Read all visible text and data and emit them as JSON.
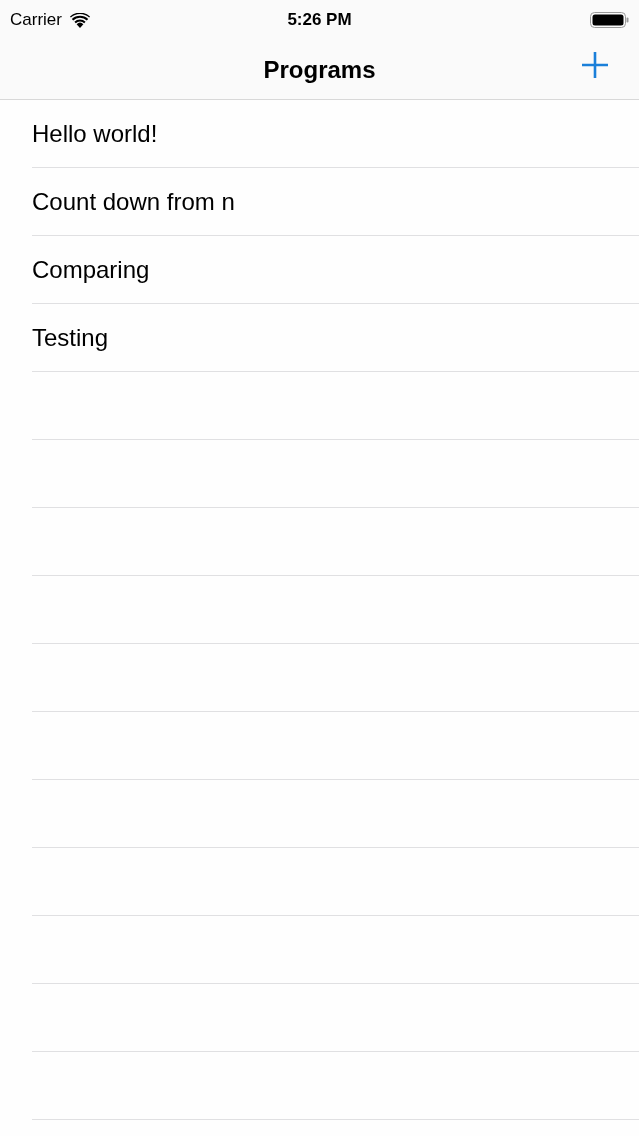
{
  "status_bar": {
    "carrier": "Carrier",
    "time": "5:26 PM"
  },
  "nav_bar": {
    "title": "Programs"
  },
  "programs": [
    {
      "title": "Hello world!"
    },
    {
      "title": "Count down from n"
    },
    {
      "title": "Comparing"
    },
    {
      "title": "Testing"
    }
  ]
}
